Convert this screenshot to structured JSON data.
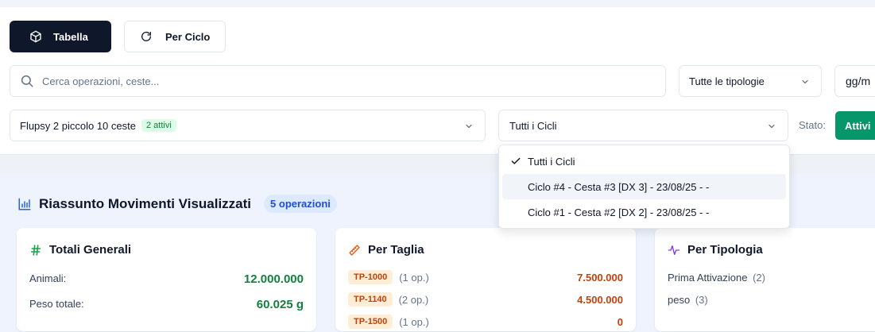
{
  "toolbar": {
    "table_label": "Tabella",
    "cycle_label": "Per Ciclo"
  },
  "filters": {
    "search_placeholder": "Cerca operazioni, ceste...",
    "type_select_value": "Tutte le tipologie",
    "date_placeholder": "gg/m",
    "flupsy_value": "Flupsy 2 piccolo 10 ceste",
    "flupsy_badge": "2 attivi",
    "cycle_select_value": "Tutti i Cicli",
    "status_label": "Stato:",
    "status_button": "Attivi"
  },
  "cycle_dropdown": {
    "options": [
      {
        "label": "Tutti i Cicli",
        "selected": true
      },
      {
        "label": "Ciclo #4 - Cesta #3 [DX 3] - 23/08/25 - -",
        "highlighted": true
      },
      {
        "label": "Ciclo #1 - Cesta #2 [DX 2] - 23/08/25 - -"
      }
    ]
  },
  "summary": {
    "title": "Riassunto Movimenti Visualizzati",
    "ops_badge": "5 operazioni",
    "totals": {
      "title": "Totali Generali",
      "rows": [
        {
          "label": "Animali:",
          "value": "12.000.000"
        },
        {
          "label": "Peso totale:",
          "value": "60.025 g"
        }
      ]
    },
    "by_size": {
      "title": "Per Taglia",
      "rows": [
        {
          "tag": "TP-1000",
          "ops": "(1 op.)",
          "value": "7.500.000"
        },
        {
          "tag": "TP-1140",
          "ops": "(2 op.)",
          "value": "4.500.000"
        },
        {
          "tag": "TP-1500",
          "ops": "(1 op.)",
          "value": "0"
        }
      ]
    },
    "by_type": {
      "title": "Per Tipologia",
      "rows": [
        {
          "label": "Prima Attivazione",
          "count": "(2)"
        },
        {
          "label": "peso",
          "count": "(3)"
        }
      ]
    }
  },
  "colors": {
    "primary_dark": "#0f172a",
    "accent_green": "#059669",
    "value_green": "#15803d",
    "size_orange": "#c2410c",
    "info_blue": "#1d4ed8"
  }
}
